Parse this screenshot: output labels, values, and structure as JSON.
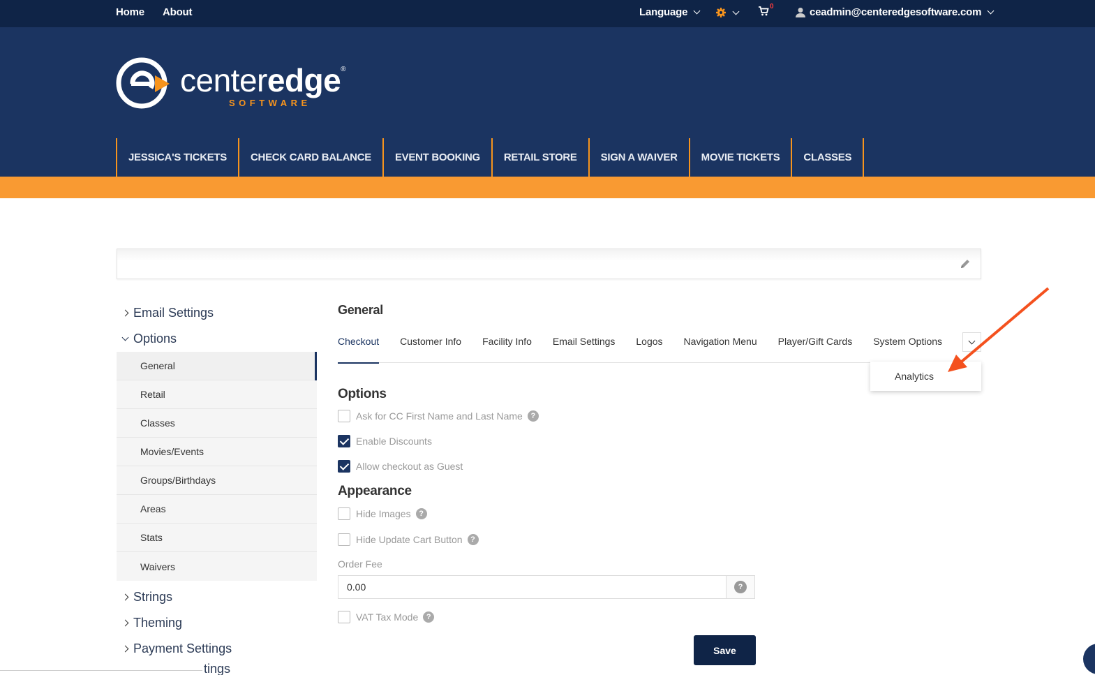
{
  "topbar": {
    "home": "Home",
    "about": "About",
    "language": "Language",
    "cart_count": "0",
    "user_email": "ceadmin@centeredgesoftware.com"
  },
  "brand": {
    "name_light": "center",
    "name_bold": "edge",
    "registered": "®",
    "subtitle": "SOFTWARE",
    "accent_color": "#f7941d",
    "navy_color": "#1b3461"
  },
  "main_nav": [
    "JESSICA'S TICKETS",
    "CHECK CARD BALANCE",
    "EVENT BOOKING",
    "RETAIL STORE",
    "SIGN A WAIVER",
    "MOVIE TICKETS",
    "CLASSES"
  ],
  "sidebar": {
    "email_settings": "Email Settings",
    "options": "Options",
    "sub_items": [
      "General",
      "Retail",
      "Classes",
      "Movies/Events",
      "Groups/Birthdays",
      "Areas",
      "Stats",
      "Waivers"
    ],
    "strings": "Strings",
    "theming": "Theming",
    "payment_settings": "Payment Settings",
    "cut_item": "tings"
  },
  "content": {
    "title": "General",
    "tabs": [
      "Checkout",
      "Customer Info",
      "Facility Info",
      "Email Settings",
      "Logos",
      "Navigation Menu",
      "Player/Gift Cards",
      "System Options"
    ],
    "dropdown_item": "Analytics",
    "options_title": "Options",
    "options": [
      {
        "label": "Ask for CC First Name and Last Name",
        "checked": false,
        "help": true
      },
      {
        "label": "Enable Discounts",
        "checked": true,
        "help": false
      },
      {
        "label": "Allow checkout as Guest",
        "checked": true,
        "help": false
      }
    ],
    "appearance_title": "Appearance",
    "appearance": [
      {
        "label": "Hide Images",
        "checked": false,
        "help": true
      },
      {
        "label": "Hide Update Cart Button",
        "checked": false,
        "help": true
      }
    ],
    "order_fee_label": "Order Fee",
    "order_fee_value": "0.00",
    "vat_label": "VAT Tax Mode",
    "help_glyph": "?",
    "save_label": "Save"
  }
}
